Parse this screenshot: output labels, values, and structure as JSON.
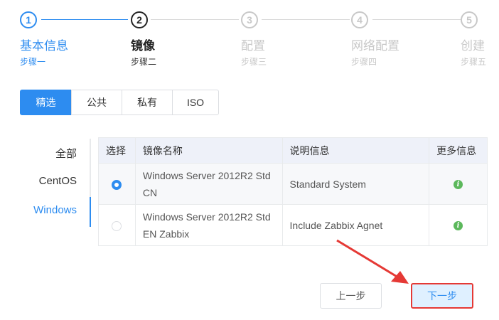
{
  "steps": [
    {
      "num": "1",
      "title": "基本信息",
      "desc": "步骤一",
      "state": "done"
    },
    {
      "num": "2",
      "title": "镜像",
      "desc": "步骤二",
      "state": "active"
    },
    {
      "num": "3",
      "title": "配置",
      "desc": "步骤三",
      "state": "pending"
    },
    {
      "num": "4",
      "title": "网络配置",
      "desc": "步骤四",
      "state": "pending"
    },
    {
      "num": "5",
      "title": "创建",
      "desc": "步骤五",
      "state": "pending"
    }
  ],
  "tabs": [
    "精选",
    "公共",
    "私有",
    "ISO"
  ],
  "active_tab": "精选",
  "sidenav": [
    "全部",
    "CentOS",
    "Windows"
  ],
  "active_nav": "Windows",
  "table": {
    "headers": [
      "选择",
      "镜像名称",
      "说明信息",
      "更多信息"
    ],
    "rows": [
      {
        "name": "Windows Server 2012R2 Std CN",
        "desc": "Standard System",
        "selected": true
      },
      {
        "name": "Windows Server 2012R2 Std EN Zabbix",
        "desc": "Include Zabbix Agnet",
        "selected": false
      }
    ]
  },
  "buttons": {
    "prev": "上一步",
    "next": "下一步"
  },
  "icons": {
    "info": "info-icon",
    "radio": "radio-icon"
  },
  "colors": {
    "accent": "#2d8cf0",
    "annotation": "#e53935",
    "info": "#5cb85c"
  }
}
